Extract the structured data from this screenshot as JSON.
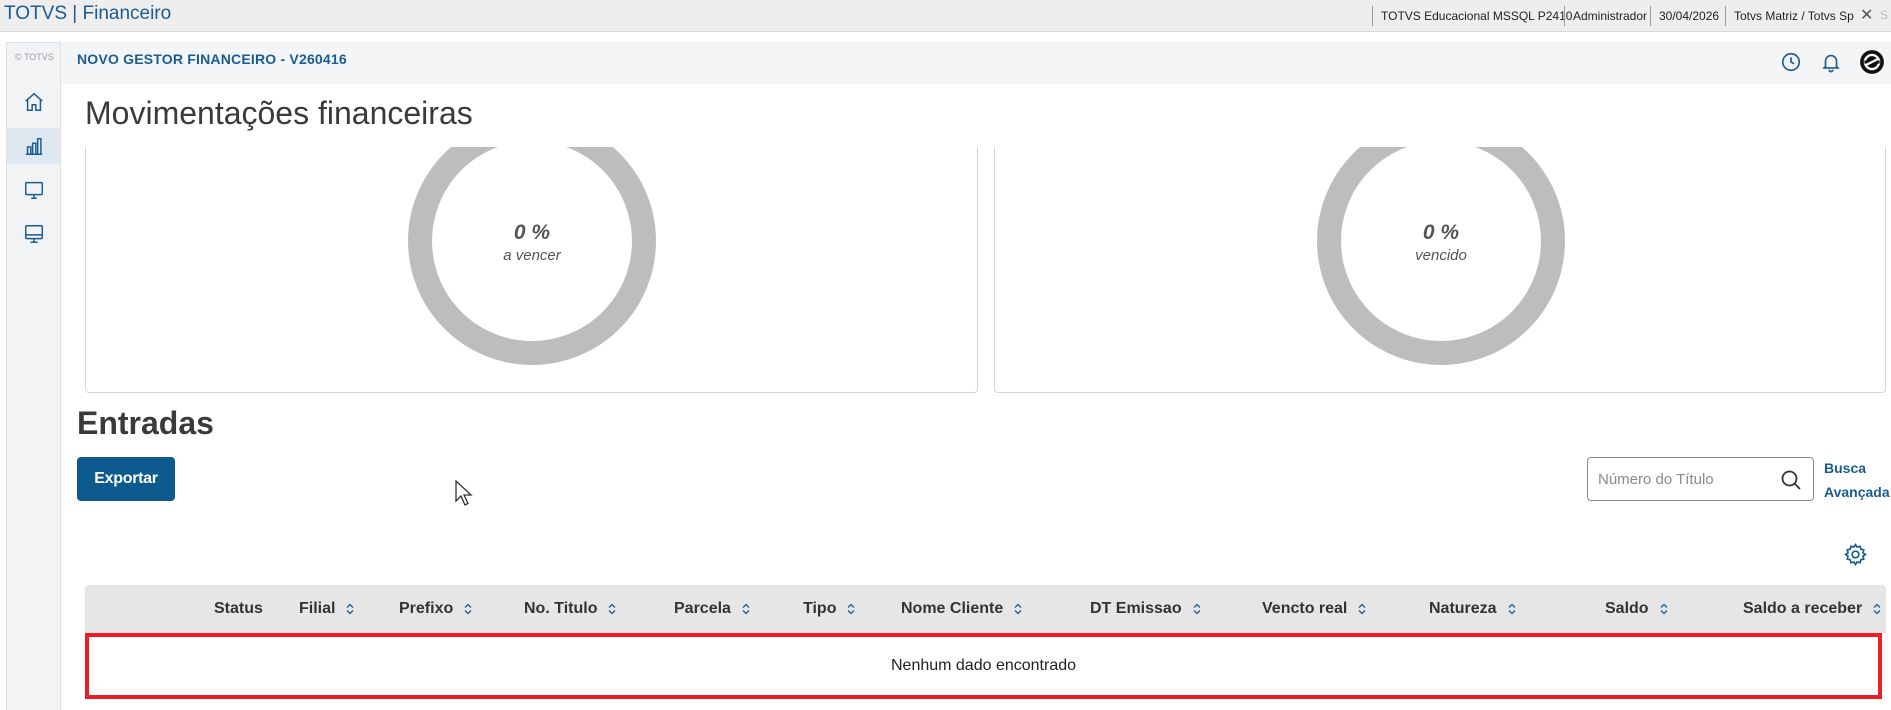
{
  "titlebar": {
    "app_title": "TOTVS | Financeiro",
    "segments": [
      "TOTVS Educacional MSSQL P2410",
      "Administrador",
      "30/04/2026",
      "Totvs Matriz / Totvs Sp"
    ],
    "close_label": "✕",
    "trailing": "S"
  },
  "sidebar": {
    "logo": "© TOTVS",
    "items": [
      {
        "name": "home",
        "icon": "home-icon"
      },
      {
        "name": "charts",
        "icon": "bar-chart-icon",
        "active": true
      },
      {
        "name": "monitor",
        "icon": "monitor-icon"
      },
      {
        "name": "desktop",
        "icon": "desktop-icon"
      }
    ]
  },
  "header": {
    "module_title": "NOVO GESTOR FINANCEIRO - V260416",
    "icons": [
      "clock-icon",
      "bell-icon",
      "totvs-logo-icon"
    ]
  },
  "main": {
    "page_title": "Movimentações financeiras",
    "donuts": [
      {
        "percent": "0 %",
        "label": "a vencer"
      },
      {
        "percent": "0 %",
        "label": "vencido"
      }
    ],
    "section_title": "Entradas",
    "export_label": "Exportar",
    "search_placeholder": "Número do Título",
    "adv_search_line1": "Busca",
    "adv_search_line2": "Avançada",
    "table": {
      "columns": [
        "Status",
        "Filial",
        "Prefixo",
        "No. Titulo",
        "Parcela",
        "Tipo",
        "Nome Cliente",
        "DT Emissao",
        "Vencto real",
        "Natureza",
        "Saldo",
        "Saldo a receber"
      ],
      "empty_message": "Nenhum dado encontrado"
    }
  },
  "colors": {
    "brand": "#1a5c92",
    "button": "#0c5a8e",
    "donut_ring": "#bdbdbd",
    "highlight": "#ee1c25"
  }
}
